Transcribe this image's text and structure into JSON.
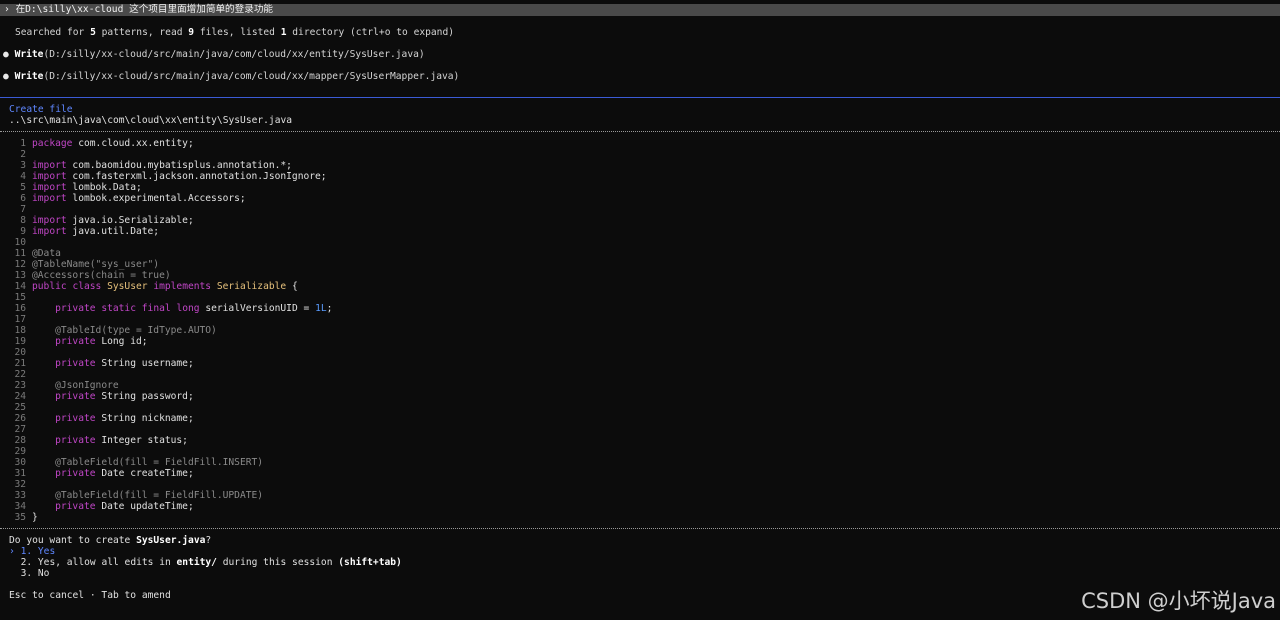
{
  "prompt": {
    "marker": "›",
    "text": "在D:\\silly\\xx-cloud 这个项目里面增加简单的登录功能"
  },
  "summary": {
    "pre": "Searched for ",
    "patterns": "5",
    "mid1": " patterns, read ",
    "files": "9",
    "mid2": " files, listed ",
    "dirs": "1",
    "post": " directory (ctrl+o to expand)"
  },
  "writes": [
    {
      "bullet": "●",
      "tool": "Write",
      "path": "(D:/silly/xx-cloud/src/main/java/com/cloud/xx/entity/SysUser.java)"
    },
    {
      "bullet": "●",
      "tool": "Write",
      "path": "(D:/silly/xx-cloud/src/main/java/com/cloud/xx/mapper/SysUserMapper.java)"
    }
  ],
  "create": {
    "title": "Create file",
    "path": "..\\src\\main\\java\\com\\cloud\\xx\\entity\\SysUser.java"
  },
  "code": {
    "n1": "1",
    "n2": "2",
    "n3": "3",
    "n4": "4",
    "n5": "5",
    "n6": "6",
    "n7": "7",
    "n8": "8",
    "n9": "9",
    "n10": "10",
    "n11": "11",
    "n12": "12",
    "n13": "13",
    "n14": "14",
    "n15": "15",
    "n16": "16",
    "n17": "17",
    "n18": "18",
    "n19": "19",
    "n20": "20",
    "n21": "21",
    "n22": "22",
    "n23": "23",
    "n24": "24",
    "n25": "25",
    "n26": "26",
    "n27": "27",
    "n28": "28",
    "n29": "29",
    "n30": "30",
    "n31": "31",
    "n32": "32",
    "n33": "33",
    "n34": "34",
    "n35": "35",
    "kw_package": "package",
    "pkg": " com.cloud.xx.entity;",
    "kw_import": "import",
    "imp3": " com.baomidou.mybatisplus.annotation.*;",
    "imp4": " com.fasterxml.jackson.annotation.JsonIgnore;",
    "imp5": " lombok.Data;",
    "imp6": " lombok.experimental.Accessors;",
    "imp8": " java.io.Serializable;",
    "imp9": " java.util.Date;",
    "ann11": "@Data",
    "ann12": "@TableName(\"sys_user\")",
    "ann13": "@Accessors(chain = true)",
    "kw_public": "public",
    "kw_class": "class",
    "cls_name": "SysUser",
    "kw_implements": "implements",
    "iface": "Serializable",
    "brace_open": " {",
    "kw_private": "private",
    "kw_static": "static",
    "kw_final": "final",
    "kw_long": "long",
    "serial_name": " serialVersionUID = ",
    "serial_val": "1L",
    "semi": ";",
    "ann18": "@TableId(type = IdType.AUTO)",
    "f19": " Long id;",
    "f21": " String username;",
    "ann23": "@JsonIgnore",
    "f24": " String password;",
    "f26": " String nickname;",
    "f28": " Integer status;",
    "ann30": "@TableField(fill = FieldFill.INSERT)",
    "f31": " Date createTime;",
    "ann33": "@TableField(fill = FieldFill.UPDATE)",
    "f34": " Date updateTime;",
    "brace_close": "}"
  },
  "question": {
    "pre": "Do you want to create ",
    "file": "SysUser.java",
    "post": "?"
  },
  "options": {
    "pointer": "›",
    "o1_num": "1.",
    "o1_text": "Yes",
    "o2_num": "2.",
    "o2_pre": "Yes, allow all edits in ",
    "o2_dir": "entity/",
    "o2_mid": " during this session ",
    "o2_key": "(shift+tab)",
    "o3_num": "3.",
    "o3_text": "No"
  },
  "footer": "Esc to cancel · Tab to amend",
  "watermark": "CSDN @小坏说Java",
  "colors": {
    "accent_blue": "#5f87ff",
    "keyword": "#c046c6",
    "type": "#e5c07b",
    "background": "#0c0c0c"
  }
}
